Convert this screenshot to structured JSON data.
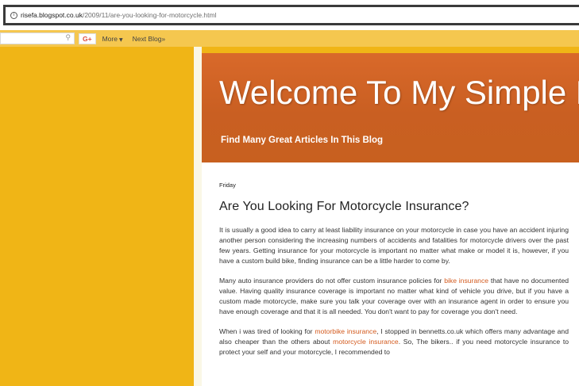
{
  "browser": {
    "url_domain": "risefa.blogspot.co.uk",
    "url_path": "/2009/11/are-you-looking-for-motorcycle.html",
    "info_icon_glyph": "i"
  },
  "navbar": {
    "search_icon_glyph": "⚲",
    "gplus_label": "G+",
    "more_label": "More",
    "more_caret": "▼",
    "next_blog_label": "Next Blog»"
  },
  "header": {
    "title": "Welcome To My Simple Blog",
    "description": "Find Many Great Articles In This Blog"
  },
  "post": {
    "date": "Friday",
    "title": "Are You Looking For Motorcycle Insurance?",
    "p1": "It is usually a good idea to carry at least liability insurance on your motorcycle in case you have an accident injuring another person considering the increasing numbers of accidents and fatalities for motorcycle drivers over the past few years. Getting insurance for your motorcycle is important no matter what make or model it is, however, if you have a custom build bike, finding insurance can be a little harder to come by.",
    "p2_a": "Many auto insurance providers do not offer custom insurance policies for ",
    "p2_link": "bike insurance",
    "p2_b": " that have no documented value. Having quality insurance coverage is important no matter what kind of vehicle you drive, but if you have a custom made motorcycle, make sure you talk your coverage over with an insurance agent in order to ensure you have enough coverage and that it is all needed. You don't want to pay for coverage you don't need.",
    "p3_a": "When i was tired of looking for ",
    "p3_link1": "motorbike insurance",
    "p3_b": ", I stopped in bennetts.co.uk which offers many advantage and also cheaper than the others about ",
    "p3_link2": "motorcycle insurance",
    "p3_c": ". So, The bikers.. if you need motorcycle insurance to protect your self and your motorcycle, I recommended to"
  },
  "colors": {
    "page_background": "#f0b516",
    "header_background": "#d9692a",
    "navbar_background": "#f5c74f",
    "link": "#d35a1e"
  }
}
